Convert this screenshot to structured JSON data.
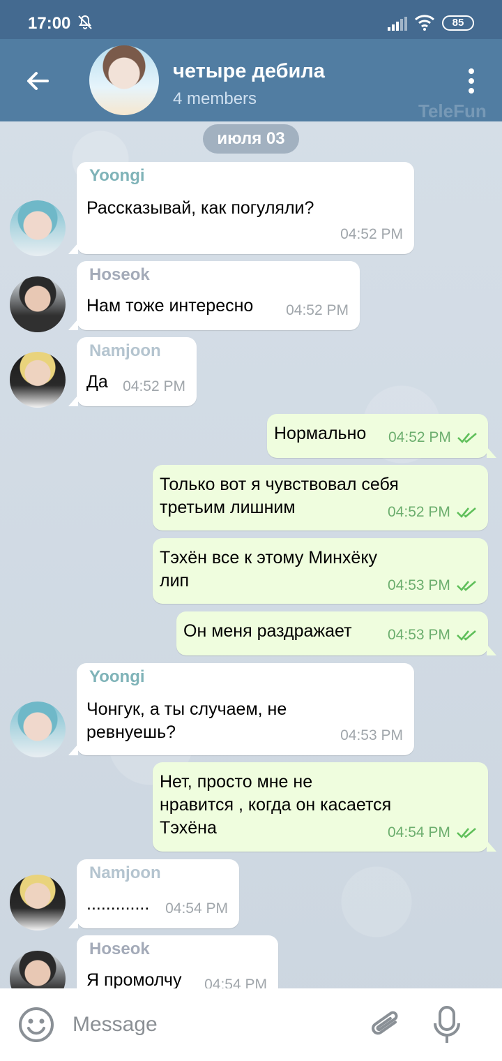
{
  "status_bar": {
    "time": "17:00",
    "battery": "85"
  },
  "header": {
    "title": "четыре дебила",
    "subtitle": "4 members",
    "watermark": "TeleFun"
  },
  "date_separator": "июля 03",
  "messages": [
    {
      "sender": "Yoongi",
      "sender_color": "#7fb3b8",
      "text": "Рассказывай, как погуляли?",
      "time": "04:52 PM"
    },
    {
      "sender": "Hoseok",
      "sender_color": "#a3aab8",
      "text": "Нам тоже интересно",
      "time": "04:52 PM"
    },
    {
      "sender": "Namjoon",
      "sender_color": "#b4c4cf",
      "text": "Да",
      "time": "04:52 PM"
    },
    {
      "text": "Нормально",
      "time": "04:52 PM"
    },
    {
      "text": "Только вот я чувствовал себя\nтретьим лишним",
      "time": "04:52 PM"
    },
    {
      "text": "Тэхён все к этому Минхёку\nлип",
      "time": "04:53 PM"
    },
    {
      "text": "Он меня раздражает",
      "time": "04:53 PM"
    },
    {
      "sender": "Yoongi",
      "sender_color": "#7fb3b8",
      "text": "Чонгук, а ты случаем, не\nревнуешь?",
      "time": "04:53 PM"
    },
    {
      "text": "Нет, просто мне не\nнравится , когда он касается\nТэхёна",
      "time": "04:54 PM"
    },
    {
      "sender": "Namjoon",
      "sender_color": "#b4c4cf",
      "text": ".............",
      "time": "04:54 PM"
    },
    {
      "sender": "Hoseok",
      "sender_color": "#a3aab8",
      "text": "Я промолчу",
      "time": "04:54 PM"
    }
  ],
  "input": {
    "placeholder": "Message"
  },
  "colors": {
    "header": "#517da2",
    "status_bar": "#446a90",
    "outgoing_bubble": "#effdde",
    "check_marks": "#5fbf5a"
  },
  "icons": [
    "mute-bell-icon",
    "signal-icon",
    "wifi-icon",
    "back-arrow-icon",
    "menu-dots-icon",
    "double-check-icon",
    "emoji-icon",
    "attach-icon",
    "mic-icon"
  ]
}
